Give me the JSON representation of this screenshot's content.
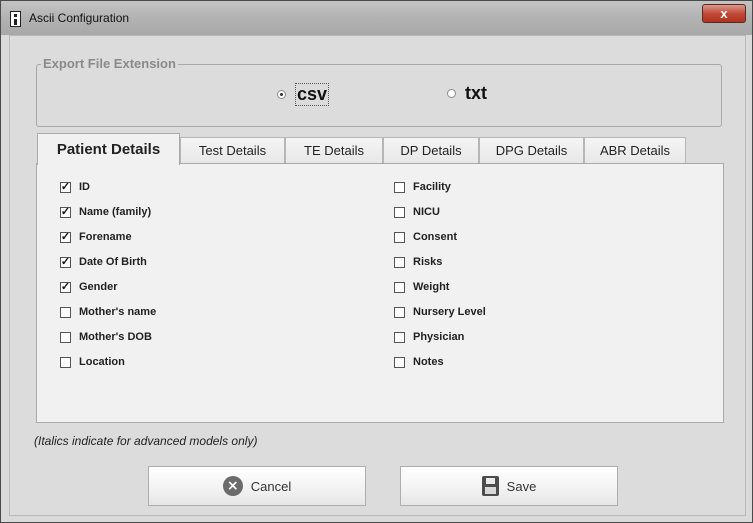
{
  "window": {
    "title": "Ascii Configuration",
    "close_label": "x"
  },
  "export": {
    "legend": "Export File Extension",
    "options": [
      {
        "label": "csv",
        "selected": true
      },
      {
        "label": "txt",
        "selected": false
      }
    ]
  },
  "tabs": [
    {
      "label": "Patient Details"
    },
    {
      "label": "Test Details"
    },
    {
      "label": "TE Details"
    },
    {
      "label": "DP Details"
    },
    {
      "label": "DPG Details"
    },
    {
      "label": "ABR Details"
    }
  ],
  "checkboxes": {
    "left": [
      {
        "label": "ID",
        "checked": true
      },
      {
        "label": "Name (family)",
        "checked": true
      },
      {
        "label": "Forename",
        "checked": true
      },
      {
        "label": "Date Of Birth",
        "checked": true
      },
      {
        "label": "Gender",
        "checked": true
      },
      {
        "label": "Mother's name",
        "checked": false
      },
      {
        "label": "Mother's DOB",
        "checked": false
      },
      {
        "label": "Location",
        "checked": false
      }
    ],
    "right": [
      {
        "label": "Facility",
        "checked": false
      },
      {
        "label": "NICU",
        "checked": false
      },
      {
        "label": "Consent",
        "checked": false
      },
      {
        "label": "Risks",
        "checked": false
      },
      {
        "label": "Weight",
        "checked": false
      },
      {
        "label": "Nursery Level",
        "checked": false
      },
      {
        "label": "Physician",
        "checked": false
      },
      {
        "label": "Notes",
        "checked": false
      }
    ]
  },
  "note": "(Italics indicate for advanced models only)",
  "buttons": {
    "cancel": "Cancel",
    "save": "Save"
  },
  "icons": {
    "app": "info-icon",
    "cancel": "cancel-x-icon",
    "save": "floppy-disk-icon"
  }
}
